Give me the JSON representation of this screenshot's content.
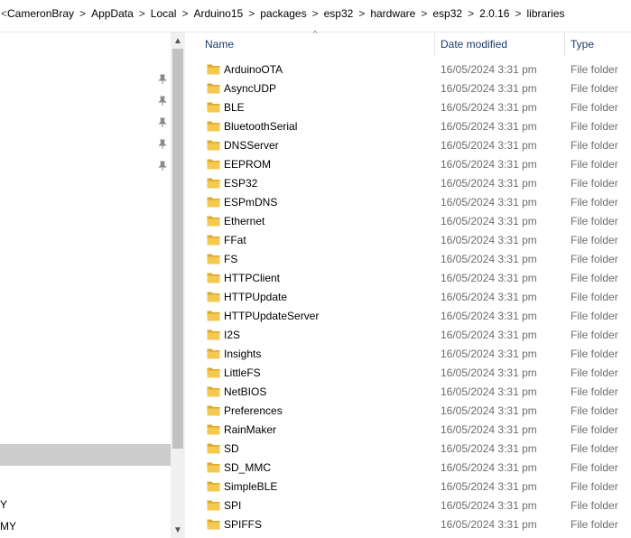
{
  "breadcrumb": {
    "edge": "<",
    "parts": [
      "CameronBray",
      "AppData",
      "Local",
      "Arduino15",
      "packages",
      "esp32",
      "hardware",
      "esp32",
      "2.0.16",
      "libraries"
    ],
    "separator": ">"
  },
  "nav": {
    "labels": [
      "Y",
      "MY"
    ]
  },
  "columns": {
    "name": "Name",
    "date": "Date modified",
    "type": "Type"
  },
  "files": [
    {
      "name": "ArduinoOTA",
      "date": "16/05/2024 3:31 pm",
      "type": "File folder"
    },
    {
      "name": "AsyncUDP",
      "date": "16/05/2024 3:31 pm",
      "type": "File folder"
    },
    {
      "name": "BLE",
      "date": "16/05/2024 3:31 pm",
      "type": "File folder"
    },
    {
      "name": "BluetoothSerial",
      "date": "16/05/2024 3:31 pm",
      "type": "File folder"
    },
    {
      "name": "DNSServer",
      "date": "16/05/2024 3:31 pm",
      "type": "File folder"
    },
    {
      "name": "EEPROM",
      "date": "16/05/2024 3:31 pm",
      "type": "File folder"
    },
    {
      "name": "ESP32",
      "date": "16/05/2024 3:31 pm",
      "type": "File folder"
    },
    {
      "name": "ESPmDNS",
      "date": "16/05/2024 3:31 pm",
      "type": "File folder"
    },
    {
      "name": "Ethernet",
      "date": "16/05/2024 3:31 pm",
      "type": "File folder"
    },
    {
      "name": "FFat",
      "date": "16/05/2024 3:31 pm",
      "type": "File folder"
    },
    {
      "name": "FS",
      "date": "16/05/2024 3:31 pm",
      "type": "File folder"
    },
    {
      "name": "HTTPClient",
      "date": "16/05/2024 3:31 pm",
      "type": "File folder"
    },
    {
      "name": "HTTPUpdate",
      "date": "16/05/2024 3:31 pm",
      "type": "File folder"
    },
    {
      "name": "HTTPUpdateServer",
      "date": "16/05/2024 3:31 pm",
      "type": "File folder"
    },
    {
      "name": "I2S",
      "date": "16/05/2024 3:31 pm",
      "type": "File folder"
    },
    {
      "name": "Insights",
      "date": "16/05/2024 3:31 pm",
      "type": "File folder"
    },
    {
      "name": "LittleFS",
      "date": "16/05/2024 3:31 pm",
      "type": "File folder"
    },
    {
      "name": "NetBIOS",
      "date": "16/05/2024 3:31 pm",
      "type": "File folder"
    },
    {
      "name": "Preferences",
      "date": "16/05/2024 3:31 pm",
      "type": "File folder"
    },
    {
      "name": "RainMaker",
      "date": "16/05/2024 3:31 pm",
      "type": "File folder"
    },
    {
      "name": "SD",
      "date": "16/05/2024 3:31 pm",
      "type": "File folder"
    },
    {
      "name": "SD_MMC",
      "date": "16/05/2024 3:31 pm",
      "type": "File folder"
    },
    {
      "name": "SimpleBLE",
      "date": "16/05/2024 3:31 pm",
      "type": "File folder"
    },
    {
      "name": "SPI",
      "date": "16/05/2024 3:31 pm",
      "type": "File folder"
    },
    {
      "name": "SPIFFS",
      "date": "16/05/2024 3:31 pm",
      "type": "File folder"
    }
  ],
  "icons": {
    "folder": "folder-icon",
    "pin": "pin-icon",
    "folder_color": "#f3c94f",
    "folder_dark": "#e0a82a"
  }
}
